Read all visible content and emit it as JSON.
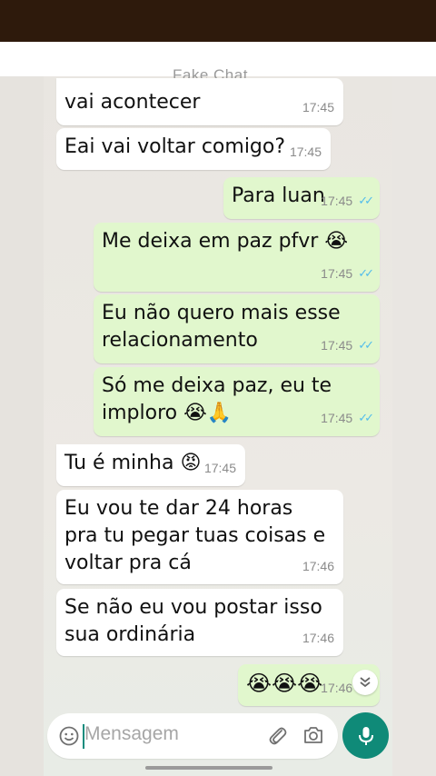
{
  "watermark": "Fake Chat",
  "messages": [
    {
      "id": "m1",
      "dir": "in",
      "text": "vai acontecer",
      "time": "17:45"
    },
    {
      "id": "m2",
      "dir": "in",
      "text": "Eai vai voltar comigo?",
      "time": "17:45"
    },
    {
      "id": "m3",
      "dir": "out",
      "text": "Para luan",
      "time": "17:45"
    },
    {
      "id": "m4",
      "dir": "out",
      "text": "Me deixa em paz pfvr 😭",
      "time": "17:45"
    },
    {
      "id": "m5",
      "dir": "out",
      "text": "Eu não quero mais esse\nrelacionamento",
      "time": "17:45"
    },
    {
      "id": "m6",
      "dir": "out",
      "text": "Só me deixa paz, eu te\nimploro 😭🙏",
      "time": "17:45"
    },
    {
      "id": "m7",
      "dir": "in",
      "text": "Tu é minha 😡",
      "time": "17:45"
    },
    {
      "id": "m8",
      "dir": "in",
      "text": "Eu vou te dar 24 horas\npra tu pegar tuas coisas e\nvoltar pra cá",
      "time": "17:46"
    },
    {
      "id": "m9",
      "dir": "in",
      "text": "Se não eu vou postar isso\nsua ordinária",
      "time": "17:46"
    },
    {
      "id": "m10",
      "dir": "out",
      "text": "😭😭😭",
      "time": "17:46"
    }
  ],
  "composer": {
    "placeholder": "Mensagem",
    "emoji_icon": "emoji-icon",
    "attach_icon": "paperclip-icon",
    "camera_icon": "camera-icon",
    "mic_icon": "microphone-icon"
  },
  "colors": {
    "incoming_bubble": "#ffffff",
    "outgoing_bubble": "#e1f7cd",
    "read_ticks": "#53bdeb",
    "mic_button": "#0f8a78"
  }
}
